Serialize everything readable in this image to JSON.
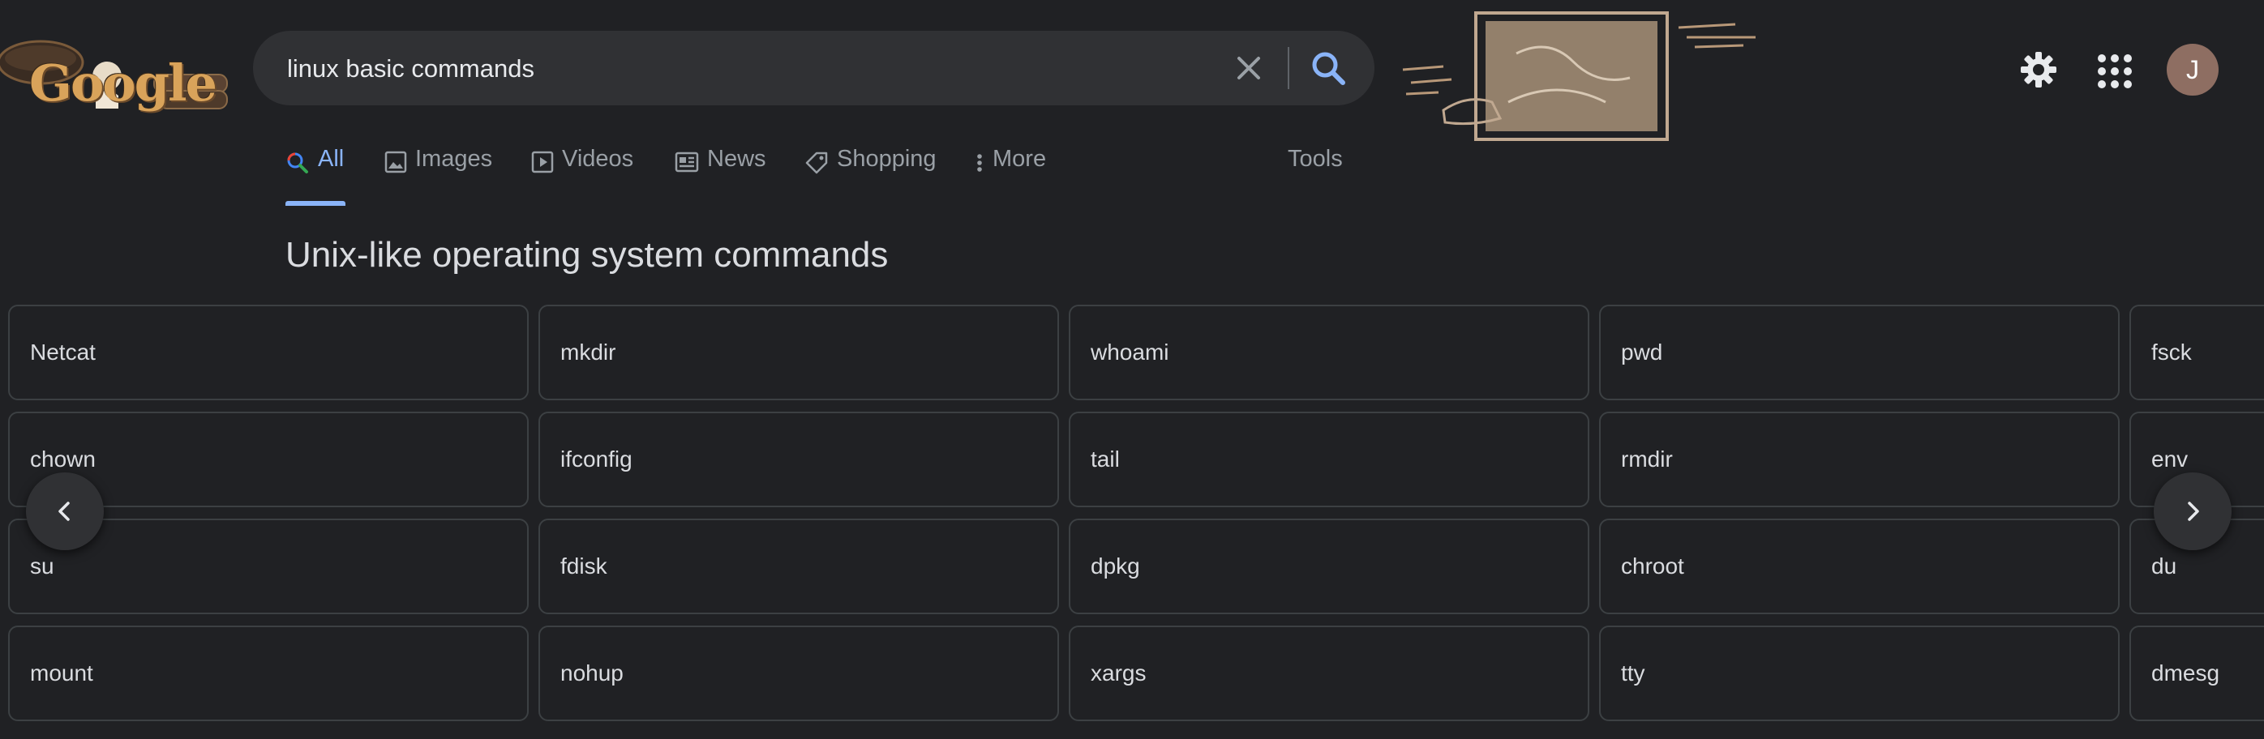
{
  "logo": {
    "text": "Google"
  },
  "search": {
    "query": "linux basic commands"
  },
  "header": {
    "avatar_initial": "J"
  },
  "tabs": [
    {
      "label": "All",
      "icon": "search-icon",
      "active": true
    },
    {
      "label": "Images",
      "icon": "image-icon",
      "active": false
    },
    {
      "label": "Videos",
      "icon": "video-icon",
      "active": false
    },
    {
      "label": "News",
      "icon": "news-icon",
      "active": false
    },
    {
      "label": "Shopping",
      "icon": "tag-icon",
      "active": false
    },
    {
      "label": "More",
      "icon": "more-vert-icon",
      "active": false
    }
  ],
  "tools_label": "Tools",
  "section_title": "Unix-like operating system commands",
  "commands": [
    [
      "Netcat",
      "mkdir",
      "whoami",
      "pwd",
      "fsck"
    ],
    [
      "chown",
      "ifconfig",
      "tail",
      "rmdir",
      "env"
    ],
    [
      "su",
      "fdisk",
      "dpkg",
      "chroot",
      "du"
    ],
    [
      "mount",
      "nohup",
      "xargs",
      "tty",
      "dmesg"
    ]
  ],
  "colors": {
    "background": "#202124",
    "accent": "#8ab4f8",
    "card_border": "#3c4043"
  }
}
